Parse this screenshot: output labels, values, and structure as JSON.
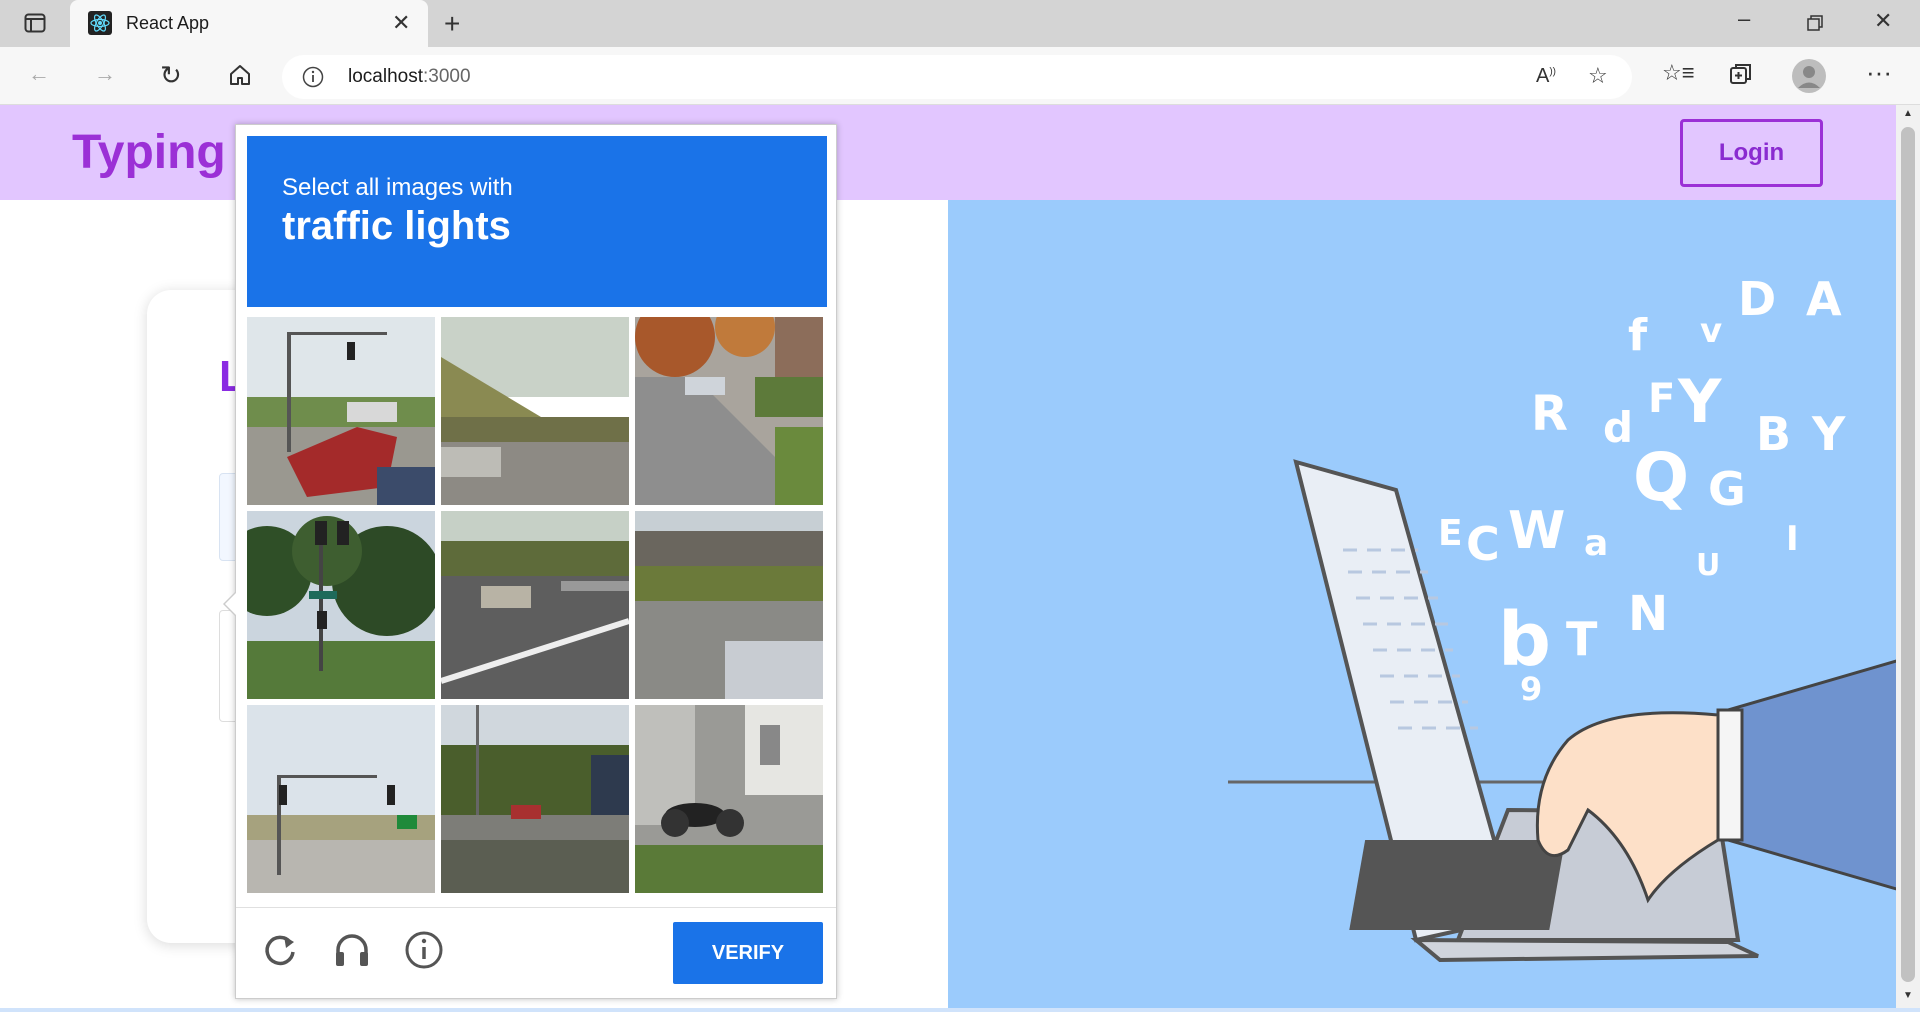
{
  "browser": {
    "tab_title": "React App",
    "url_host": "localhost",
    "url_port": ":3000"
  },
  "page": {
    "brand": "Typing",
    "login_label": "Login",
    "card_title_partial": "L"
  },
  "captcha": {
    "instruction": "Select all images with",
    "target": "traffic lights",
    "tiles": [
      "street-intersection-red-truck",
      "road-with-grass",
      "tree-lined-street",
      "traffic-light-pole-trees",
      "highway-cars",
      "overpass-road",
      "traffic-lights-highway",
      "bridge-highway",
      "motorcycle-house"
    ],
    "verify_label": "VERIFY"
  },
  "colors": {
    "header_bg": "#e2c6ff",
    "brand": "#9b30d6",
    "captcha_blue": "#1a73e8",
    "hero_bg": "#9bcbfc"
  }
}
